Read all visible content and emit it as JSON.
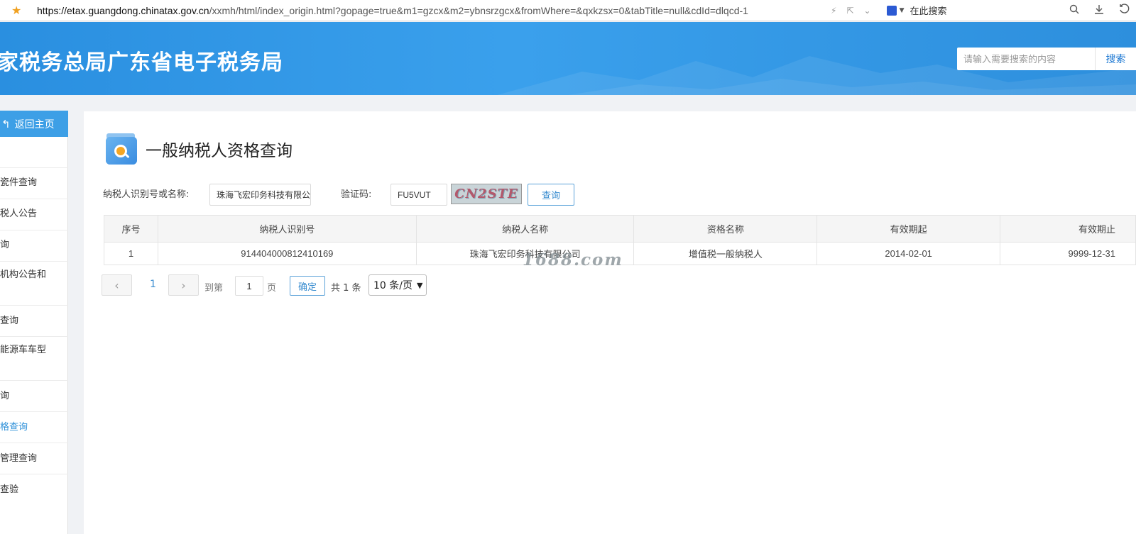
{
  "browser": {
    "url_host": "https://etax.guangdong.chinatax.gov.cn",
    "url_path": "/xxmh/html/index_origin.html?gopage=true&m1=gzcx&m2=ybnsrzgcx&fromWhere=&qxkzsx=0&tabTitle=null&cdId=dlqcd-1",
    "search_engine_label": "在此搜索"
  },
  "header": {
    "site_title": "家税务总局广东省电子税务局",
    "search_placeholder": "请输入需要搜索的内容",
    "search_button": "搜索"
  },
  "sidebar": {
    "back_label": "返回主页",
    "items": [
      {
        "label": "瓷件查询"
      },
      {
        "label": "税人公告"
      },
      {
        "label": "询"
      },
      {
        "label": "机构公告和"
      },
      {
        "label": "查询"
      },
      {
        "label": "能源车车型"
      },
      {
        "label": "询"
      },
      {
        "label": "格查询"
      },
      {
        "label": "管理查询"
      },
      {
        "label": "查验"
      }
    ]
  },
  "page": {
    "title": "一般纳税人资格查询"
  },
  "form": {
    "taxpayer_label": "纳税人识别号或名称:",
    "taxpayer_value": "珠海飞宏印务科技有限公",
    "captcha_label": "验证码:",
    "captcha_value": "FU5VUT",
    "captcha_image_text": "CN2STE",
    "query_button": "查询"
  },
  "table": {
    "headers": [
      "序号",
      "纳税人识别号",
      "纳税人名称",
      "资格名称",
      "有效期起",
      "有效期止"
    ],
    "rows": [
      [
        "1",
        "914404000812410169",
        "珠海飞宏印务科技有限公司",
        "增值税一般纳税人",
        "2014-02-01",
        "9999-12-31"
      ]
    ]
  },
  "watermark": "1688.com",
  "pagination": {
    "prev": "‹",
    "current_page": "1",
    "next": "›",
    "goto_label": "到第",
    "goto_value": "1",
    "page_unit": "页",
    "confirm": "确定",
    "total": "共 1 条",
    "page_size": "10 条/页"
  },
  "colors": {
    "header_blue": "#2a8fe0",
    "accent": "#3a8dd0",
    "back_button": "#3d9fe6"
  }
}
